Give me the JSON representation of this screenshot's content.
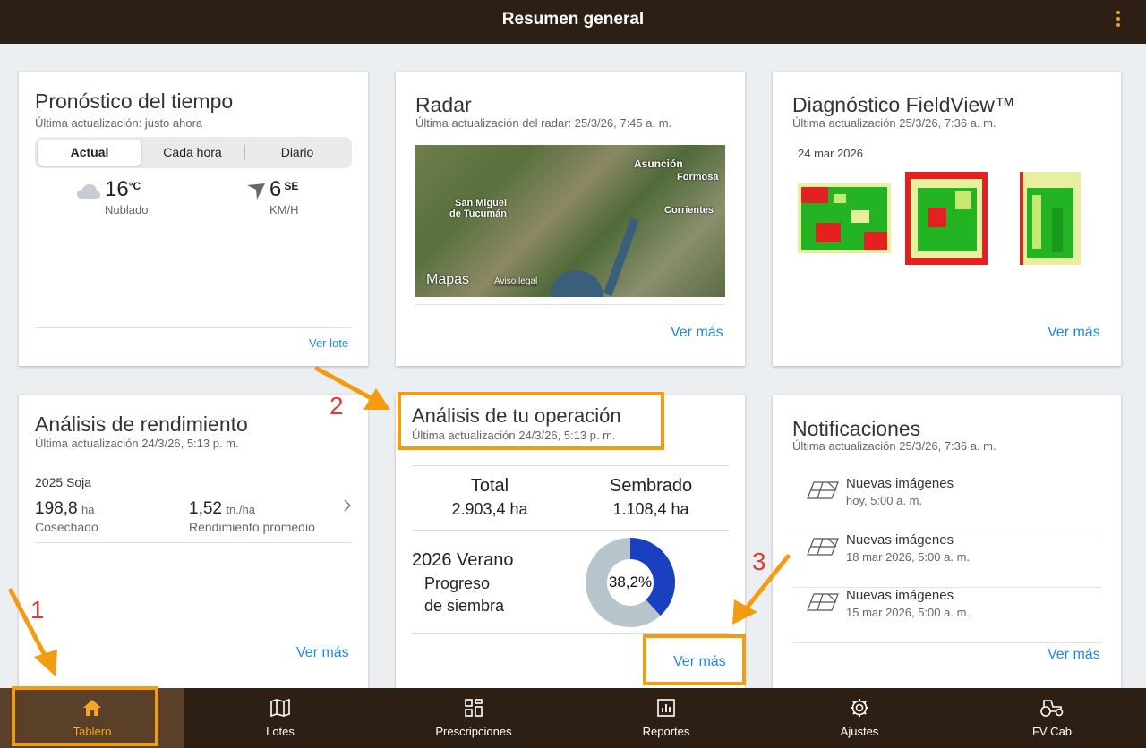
{
  "header": {
    "title": "Resumen general",
    "menu_icon": "kebab-menu-icon"
  },
  "weather": {
    "title": "Pronóstico del tiempo",
    "subtitle": "Última actualización: justo ahora",
    "tabs": [
      "Actual",
      "Cada hora",
      "Diario"
    ],
    "active_tab": "Actual",
    "temp_value": "16",
    "temp_unit": "°C",
    "condition": "Nublado",
    "wind_value": "6",
    "wind_dir": "SE",
    "wind_unit": "KM/H",
    "link": "Ver lote"
  },
  "radar": {
    "title": "Radar",
    "subtitle": "Última actualización del radar: 25/3/26, 7:45 a. m.",
    "map_labels": [
      "Asunción",
      "Formosa",
      "San Miguel",
      "de Tucumán",
      "Corrientes"
    ],
    "map_brand": "Mapas",
    "map_legal": "Aviso legal",
    "link": "Ver más"
  },
  "fieldview": {
    "title": "Diagnóstico FieldView™",
    "subtitle": "Última actualización 25/3/26, 7:36 a. m.",
    "date": "24 mar 2026",
    "link": "Ver más"
  },
  "yield": {
    "title": "Análisis de rendimiento",
    "subtitle": "Última actualización 24/3/26, 5:13 p. m.",
    "season": "2025 Soja",
    "harvested_value": "198,8",
    "harvested_unit": "ha",
    "harvested_label": "Cosechado",
    "avg_value": "1,52",
    "avg_unit": "tn./ha",
    "avg_label": "Rendimiento promedio",
    "link": "Ver más"
  },
  "operation": {
    "title": "Análisis de tu operación",
    "subtitle": "Última actualización 24/3/26, 5:13 p. m.",
    "total_label": "Total",
    "total_value": "2.903,4 ha",
    "sown_label": "Sembrado",
    "sown_value": "1.108,4 ha",
    "season": "2026 Verano",
    "progress_label_1": "Progreso",
    "progress_label_2": "de siembra",
    "progress_text": "38,2%",
    "progress_fraction": 0.382,
    "link": "Ver más",
    "progress_color": "#1a3fbf",
    "track_color": "#b8c4cc"
  },
  "notifications": {
    "title": "Notificaciones",
    "subtitle": "Última actualización 25/3/26, 7:36 a. m.",
    "items": [
      {
        "title": "Nuevas imágenes",
        "date": "hoy, 5:00 a. m."
      },
      {
        "title": "Nuevas imágenes",
        "date": "18 mar 2026, 5:00 a. m."
      },
      {
        "title": "Nuevas imágenes",
        "date": "15 mar 2026, 5:00 a. m."
      }
    ],
    "link": "Ver más"
  },
  "annotations": {
    "n1": "1",
    "n2": "2",
    "n3": "3",
    "color": "#f39c12"
  },
  "nav": {
    "items": [
      {
        "label": "Tablero",
        "icon": "home-icon"
      },
      {
        "label": "Lotes",
        "icon": "map-icon"
      },
      {
        "label": "Prescripciones",
        "icon": "grid-icon"
      },
      {
        "label": "Reportes",
        "icon": "chart-icon"
      },
      {
        "label": "Ajustes",
        "icon": "gear-icon"
      },
      {
        "label": "FV Cab",
        "icon": "tractor-icon"
      }
    ],
    "active": "Tablero"
  }
}
